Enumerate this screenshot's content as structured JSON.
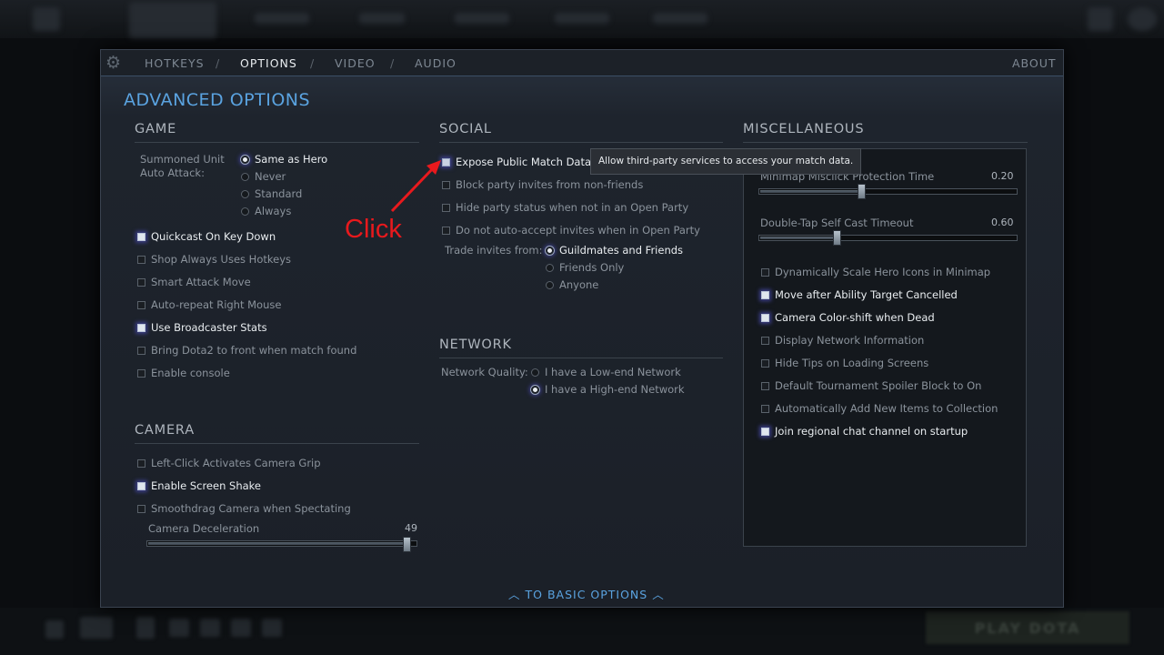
{
  "tabs": [
    "HOTKEYS",
    "OPTIONS",
    "VIDEO",
    "AUDIO"
  ],
  "about": "ABOUT",
  "title": "ADVANCED OPTIONS",
  "game": {
    "title": "GAME",
    "summoned_label_1": "Summoned Unit",
    "summoned_label_2": "Auto Attack:",
    "radios": [
      "Same as Hero",
      "Never",
      "Standard",
      "Always"
    ],
    "checks": [
      {
        "label": "Quickcast On Key Down",
        "on": true
      },
      {
        "label": "Shop Always Uses Hotkeys",
        "on": false
      },
      {
        "label": "Smart Attack Move",
        "on": false
      },
      {
        "label": "Auto-repeat Right Mouse",
        "on": false
      },
      {
        "label": "Use Broadcaster Stats",
        "on": true
      },
      {
        "label": "Bring Dota2 to front when match found",
        "on": false
      },
      {
        "label": "Enable console",
        "on": false
      }
    ]
  },
  "camera": {
    "title": "CAMERA",
    "checks": [
      {
        "label": "Left-Click Activates Camera Grip",
        "on": false
      },
      {
        "label": "Enable Screen Shake",
        "on": true
      },
      {
        "label": "Smoothdrag Camera when Spectating",
        "on": false
      }
    ],
    "decel_label": "Camera Deceleration",
    "decel_value": "49"
  },
  "social": {
    "title": "SOCIAL",
    "checks": [
      {
        "label": "Expose Public Match Data",
        "on": false
      },
      {
        "label": "Block party invites from non-friends",
        "on": false
      },
      {
        "label": "Hide party status when not in an Open Party",
        "on": false
      },
      {
        "label": "Do not auto-accept invites when in Open Party",
        "on": false
      }
    ],
    "trade_label": "Trade invites from:",
    "trade_radios": [
      "Guildmates and Friends",
      "Friends Only",
      "Anyone"
    ]
  },
  "network": {
    "title": "NETWORK",
    "quality_label": "Network Quality:",
    "radios": [
      "I have a Low-end Network",
      "I have a High-end Network"
    ]
  },
  "misc": {
    "title": "MISCELLANEOUS",
    "slider1_label": "Minimap Misclick Protection Time",
    "slider1_value": "0.20",
    "slider2_label": "Double-Tap Self Cast Timeout",
    "slider2_value": "0.60",
    "checks": [
      {
        "label": "Dynamically Scale Hero Icons in Minimap",
        "on": false
      },
      {
        "label": "Move after Ability Target Cancelled",
        "on": true
      },
      {
        "label": "Camera Color-shift when Dead",
        "on": true
      },
      {
        "label": "Display Network Information",
        "on": false
      },
      {
        "label": "Hide Tips on Loading Screens",
        "on": false
      },
      {
        "label": "Default Tournament Spoiler Block to On",
        "on": false
      },
      {
        "label": "Automatically Add New Items to Collection",
        "on": false
      },
      {
        "label": "Join regional chat channel on startup",
        "on": true
      }
    ]
  },
  "tooltip": "Allow third-party services to access your match data.",
  "basic_link": "TO BASIC OPTIONS",
  "annotation": "Click",
  "play_button": "PLAY DOTA",
  "colors": {
    "accent": "#5aa3e0",
    "annotation": "#e8191d",
    "panel": "#1b2028"
  }
}
